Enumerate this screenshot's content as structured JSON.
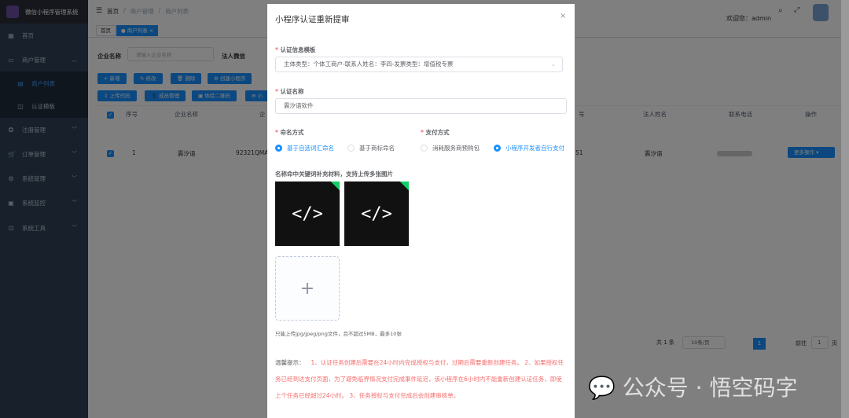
{
  "app": {
    "title": "微信小程序管理系统"
  },
  "sidebar": {
    "items": [
      {
        "label": "首页",
        "icon": "dashboard-icon"
      },
      {
        "label": "商户管理",
        "icon": "shop-icon"
      },
      {
        "label": "商户列表",
        "icon": "list-icon"
      },
      {
        "label": "认证模板",
        "icon": "template-icon"
      },
      {
        "label": "注册管理",
        "icon": "register-icon"
      },
      {
        "label": "订单管理",
        "icon": "cart-icon"
      },
      {
        "label": "系统管理",
        "icon": "gear-icon"
      },
      {
        "label": "系统监控",
        "icon": "monitor-icon"
      },
      {
        "label": "系统工具",
        "icon": "tool-icon"
      }
    ]
  },
  "header": {
    "breadcrumb": [
      "首页",
      "商户管理",
      "商户列表"
    ],
    "welcome": "欢迎您：admin"
  },
  "tags": {
    "home": "首页",
    "active": "● 商户列表 ×"
  },
  "search": {
    "company_label": "企业名称",
    "company_placeholder": "请输入企业名称",
    "legal_label": "法人微信"
  },
  "toolbar": {
    "row1": [
      "+ 新增",
      "✎ 修改",
      "🗑 删除",
      "⚙ 创建小程序"
    ],
    "row2": [
      "⇪ 上传代码",
      "👤 成员管理",
      "▣ 体验二维码",
      "✉ 小"
    ]
  },
  "table": {
    "headers": [
      "序号",
      "企业名称",
      "企",
      "号",
      "法人姓名",
      "联系电话",
      "操作"
    ],
    "row": {
      "index": "1",
      "company": "震汐语",
      "code": "92321QMA",
      "num": "51",
      "legal": "震汐语",
      "more": "更多操作"
    }
  },
  "pagination": {
    "total": "共 1 条",
    "size": "10条/页",
    "page": "1",
    "goto": "前往",
    "goto_value": "1",
    "unit": "页"
  },
  "watermark": "公众号 · 悟空码字",
  "modal": {
    "title": "小程序认证重新提审",
    "template_label": "认证信息模板",
    "template_value": "主体类型：个体工商户-联系人姓名：李四-发票类型：增值税专票",
    "name_label": "认证名称",
    "name_value": "震汐语软件",
    "naming_label": "命名方式",
    "naming_options": [
      "基于自选词汇命名",
      "基于商标命名"
    ],
    "pay_label": "支付方式",
    "pay_options": [
      "消耗服务商预购包",
      "小程序开发者自行支付"
    ],
    "upload_label": "名称命中关键词补充材料，支持上传多张图片",
    "upload_hint": "只能上传jpg/jpeg/png文件，且不超过5MB，最多10张",
    "images": [
      "</>",
      "</>"
    ],
    "tip_label": "温馨提示：",
    "tip_text": "1、认证任务创建后需要在24小时内完成授权与支付，过期后需要重新创建任务。 2、如果授权任务已经到达支付页面，为了避免临界情况支付完成事件延迟，该小程序在6小时内不能重新创建认证任务，即使上个任务已经超过24小时。 3、任务授权与支付完成后会创建审核单。"
  }
}
